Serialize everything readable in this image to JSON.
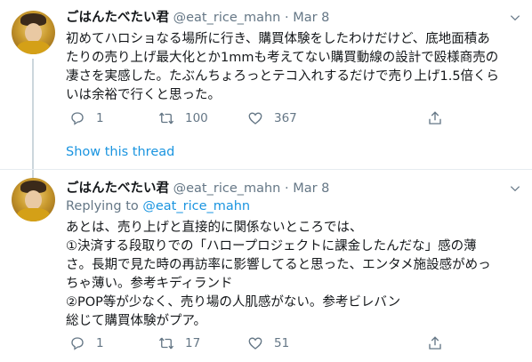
{
  "tweet1": {
    "display_name": "ごはんたべたい君",
    "handle": "@eat_rice_mahn",
    "separator": "·",
    "date": "Mar 8",
    "lines": [
      "初めてハロショなる場所に行き、購買体験をしたわけだけど、底地面積あ",
      "たりの売り上げ最大化とか1mmも考えてない購買動線の設計で殴様商売の",
      "凄さを実感した。たぶんちょろっとテコ入れするだけで売り上げ1.5倍くら",
      "いは余裕で行くと思った。"
    ],
    "replies": "1",
    "retweets": "100",
    "likes": "367"
  },
  "show_thread": "Show this thread",
  "tweet2": {
    "display_name": "ごはんたべたい君",
    "handle": "@eat_rice_mahn",
    "separator": "·",
    "date": "Mar 8",
    "replying_prefix": "Replying to",
    "replying_handle": "@eat_rice_mahn",
    "lines": [
      "あとは、売り上げと直接的に関係ないところでは、",
      "①決済する段取りでの「ハロープロジェクトに課金したんだな」感の薄",
      "さ。長期で見た時の再訪率に影響してると思った、エンタメ施設感がめっ",
      "ちゃ薄い。参考キディランド",
      "②POP等が少なく、売り場の人肌感がない。参考ビレバン",
      "総じて購買体験がプア。"
    ],
    "replies": "1",
    "retweets": "17",
    "likes": "51"
  },
  "icons": [
    "avatar",
    "more-caret-icon",
    "reply-icon",
    "retweet-icon",
    "like-icon",
    "share-icon"
  ]
}
